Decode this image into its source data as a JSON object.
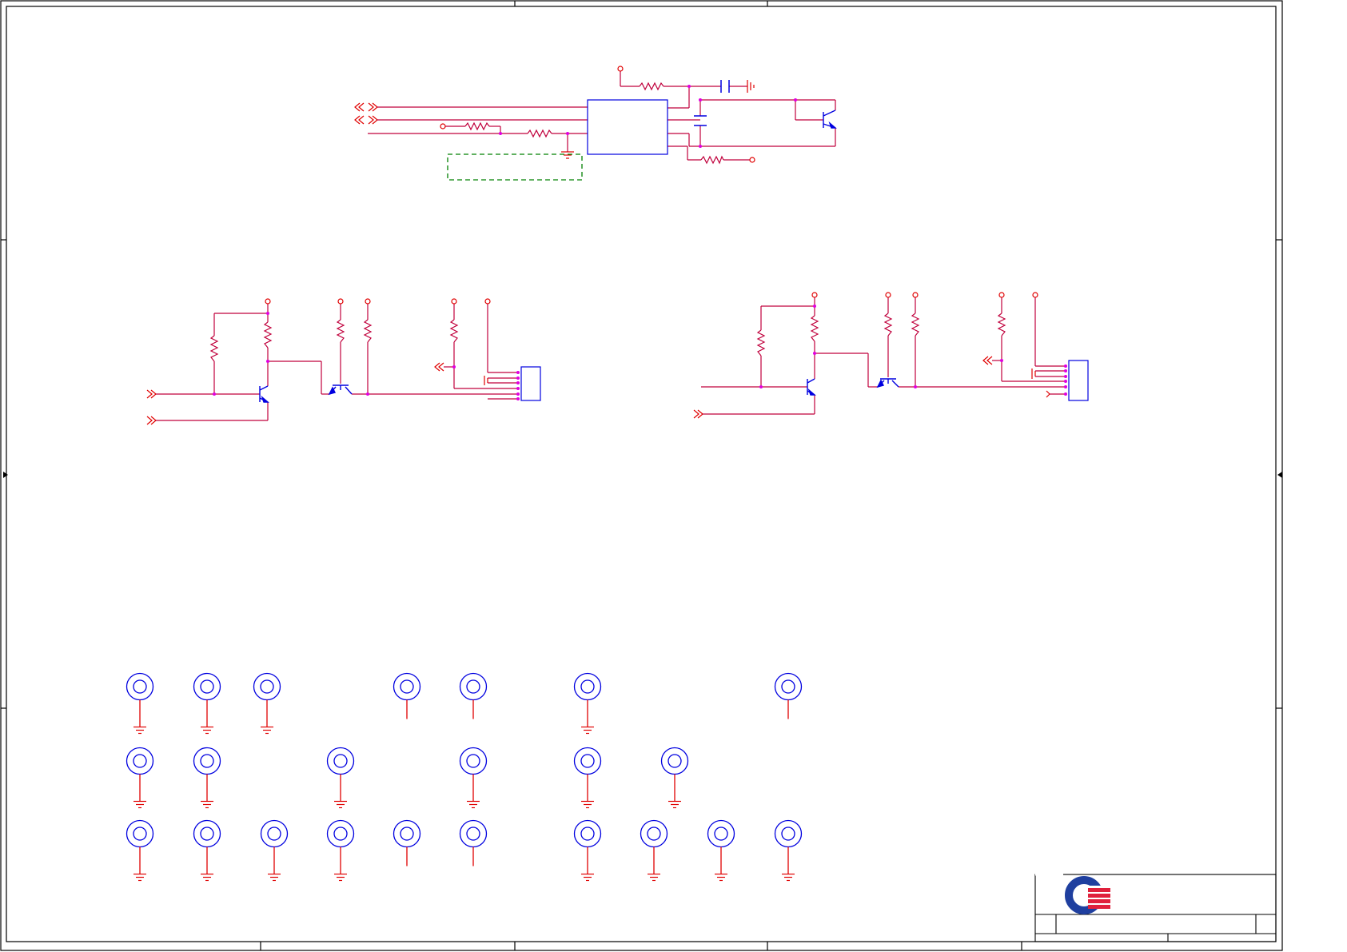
{
  "colors": {
    "background": "#ffffff",
    "frame": "#000000",
    "wire": "#c0003c",
    "component": "#0000e0",
    "power_symbol": "#e00000",
    "junction": "#e000e0",
    "keepout_outline": "#008000",
    "logo_blue": "#1f3f9f",
    "logo_red": "#e0203c"
  },
  "icons": {
    "resistor": "resistor-icon",
    "capacitor": "capacitor-icon",
    "transistor_npn": "npn-transistor-icon",
    "transistor_fet": "mosfet-icon",
    "ground": "ground-icon",
    "power_port": "power-port-icon",
    "offpage_connector": "offpage-connector-icon",
    "header": "connector-header-icon",
    "mounting_hole": "mounting-hole-icon",
    "logo": "company-logo-icon"
  },
  "mounting_holes": {
    "row1_grounded": [
      true,
      true,
      true,
      false,
      false,
      true,
      false
    ],
    "row2_grounded": [
      true,
      true,
      true,
      true,
      true,
      true
    ],
    "row3_grounded": [
      true,
      true,
      true,
      true,
      false,
      false,
      true,
      true,
      true,
      true
    ]
  }
}
